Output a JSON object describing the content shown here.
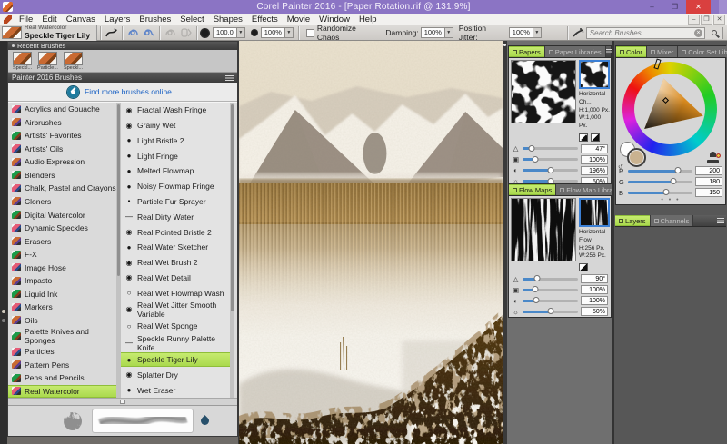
{
  "window": {
    "title": "Corel Painter 2016 - [Paper Rotation.rif @ 131.9%]",
    "controls": {
      "minimize": "–",
      "restore": "❐",
      "close": "✕"
    }
  },
  "menubar": {
    "items": [
      "File",
      "Edit",
      "Canvas",
      "Layers",
      "Brushes",
      "Select",
      "Shapes",
      "Effects",
      "Movie",
      "Window",
      "Help"
    ],
    "doc_controls": {
      "minimize": "–",
      "restore": "❐",
      "close": "✕"
    }
  },
  "property_bar": {
    "brush_category": "Real Watercolor",
    "brush_variant": "Speckle Tiger Lily",
    "size_value": "100.0",
    "opacity_value": "100%",
    "dropdown_arrow": "▼",
    "randomize_chaos_label": "Randomize Chaos",
    "damping_label": "Damping:",
    "damping_value": "100%",
    "position_jitter_label": "Position Jitter:",
    "position_jitter_value": "100%",
    "search_placeholder": "Search Brushes",
    "clear_glyph": "×"
  },
  "brush_selector": {
    "recent_header": "Recent Brushes",
    "recent": [
      {
        "label": "Speckl..."
      },
      {
        "label": "Particle..."
      },
      {
        "label": "Speckl..."
      }
    ],
    "library_header": "Painter 2016 Brushes",
    "find_more_label": "Find more brushes online...",
    "categories": [
      {
        "label": "Acrylics and Gouache"
      },
      {
        "label": "Airbrushes"
      },
      {
        "label": "Artists' Favorites"
      },
      {
        "label": "Artists' Oils"
      },
      {
        "label": "Audio Expression"
      },
      {
        "label": "Blenders"
      },
      {
        "label": "Chalk, Pastel and Crayons"
      },
      {
        "label": "Cloners"
      },
      {
        "label": "Digital Watercolor"
      },
      {
        "label": "Dynamic Speckles"
      },
      {
        "label": "Erasers"
      },
      {
        "label": "F-X"
      },
      {
        "label": "Image Hose"
      },
      {
        "label": "Impasto"
      },
      {
        "label": "Liquid Ink"
      },
      {
        "label": "Markers"
      },
      {
        "label": "Oils"
      },
      {
        "label": "Palette Knives and Sponges"
      },
      {
        "label": "Particles"
      },
      {
        "label": "Pattern Pens"
      },
      {
        "label": "Pens and Pencils"
      },
      {
        "label": "Real Watercolor",
        "selected": true
      }
    ],
    "variants": [
      {
        "icon": "◉",
        "label": "Fractal Wash Fringe"
      },
      {
        "icon": "◉",
        "label": "Grainy Wet"
      },
      {
        "icon": "●",
        "label": "Light Bristle 2"
      },
      {
        "icon": "●",
        "label": "Light Fringe"
      },
      {
        "icon": "●",
        "label": "Melted Flowmap"
      },
      {
        "icon": "●",
        "label": "Noisy Flowmap Fringe"
      },
      {
        "icon": "•",
        "label": "Particle Fur Sprayer"
      },
      {
        "icon": "—",
        "label": "Real Dirty Water"
      },
      {
        "icon": "◉",
        "label": "Real Pointed Bristle 2"
      },
      {
        "icon": "●",
        "label": "Real Water Sketcher"
      },
      {
        "icon": "◉",
        "label": "Real Wet Brush 2"
      },
      {
        "icon": "◉",
        "label": "Real Wet Detail"
      },
      {
        "icon": "○",
        "label": "Real Wet Flowmap Wash"
      },
      {
        "icon": "◉",
        "label": "Real Wet Jitter Smooth Variable"
      },
      {
        "icon": "○",
        "label": "Real Wet Sponge"
      },
      {
        "icon": "—",
        "label": "Speckle Runny Palette Knife"
      },
      {
        "icon": "●",
        "label": "Speckle Tiger Lily",
        "selected": true
      },
      {
        "icon": "◉",
        "label": "Splatter Dry"
      },
      {
        "icon": "●",
        "label": "Wet Eraser"
      }
    ]
  },
  "papers_panel": {
    "tabs": [
      {
        "label": "Papers",
        "selected": true
      },
      {
        "label": "Paper Libraries"
      }
    ],
    "paper_name": "Horizontal Ch...",
    "height_label": "H:1,000 Px.",
    "width_label": "W:1,000 Px.",
    "sliders": [
      {
        "icon": "△",
        "name": "rotation",
        "value": "47°",
        "pos": 17
      },
      {
        "icon": "▣",
        "name": "scale",
        "value": "100%",
        "pos": 23
      },
      {
        "icon": "◐",
        "name": "contrast",
        "value": "196%",
        "pos": 50
      },
      {
        "icon": "☼",
        "name": "brightness",
        "value": "50%",
        "pos": 51
      }
    ]
  },
  "flow_maps_panel": {
    "tabs": [
      {
        "label": "Flow Maps",
        "selected": true
      },
      {
        "label": "Flow Map Libraries"
      }
    ],
    "map_name": "Horizontal Flow",
    "height_label": "H:256 Px.",
    "width_label": "W:256 Px.",
    "sliders": [
      {
        "icon": "△",
        "name": "rotation",
        "value": "90°",
        "pos": 27
      },
      {
        "icon": "▣",
        "name": "scale",
        "value": "100%",
        "pos": 23
      },
      {
        "icon": "◐",
        "name": "contrast",
        "value": "100%",
        "pos": 25
      },
      {
        "icon": "☼",
        "name": "brightness",
        "value": "50%",
        "pos": 50
      }
    ]
  },
  "color_panel": {
    "tabs": [
      {
        "label": "Color",
        "selected": true
      },
      {
        "label": "Mixer"
      },
      {
        "label": "Color Set Libraries"
      }
    ],
    "sliders": [
      {
        "label": "R",
        "value": "200",
        "pos": 78
      },
      {
        "label": "G",
        "value": "180",
        "pos": 71
      },
      {
        "label": "B",
        "value": "150",
        "pos": 59
      }
    ]
  },
  "layers_panel": {
    "tabs": [
      {
        "label": "Layers",
        "selected": true
      },
      {
        "label": "Channels"
      }
    ]
  },
  "colors": {
    "titlebar_purple": "#8b74c4",
    "selection_green": "#b5e05a",
    "slider_blue": "#4a88c8",
    "current_swatch": "#c9b290"
  }
}
